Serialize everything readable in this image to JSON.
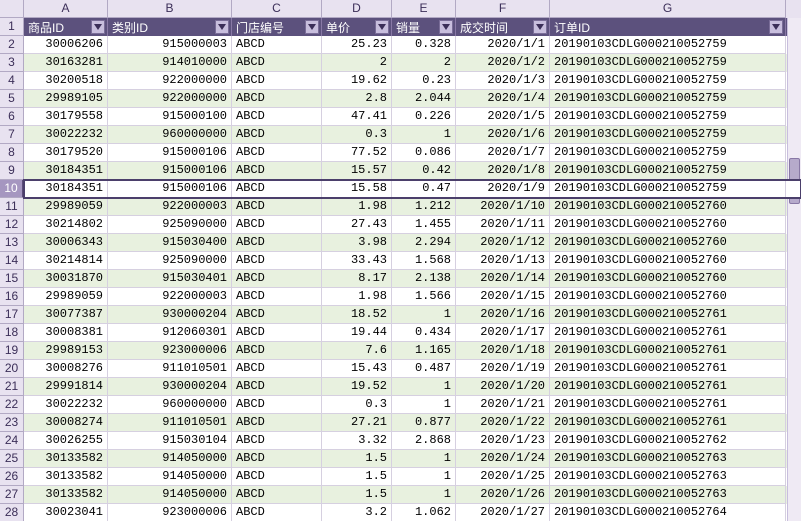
{
  "columns": [
    "A",
    "B",
    "C",
    "D",
    "E",
    "F",
    "G"
  ],
  "selected_row": 10,
  "headers": {
    "A": "商品ID",
    "B": "类别ID",
    "C": "门店编号",
    "D": "单价",
    "E": "销量",
    "F": "成交时间",
    "G": "订单ID"
  },
  "chart_data": {
    "type": "table",
    "columns": [
      "商品ID",
      "类别ID",
      "门店编号",
      "单价",
      "销量",
      "成交时间",
      "订单ID"
    ],
    "rows": [
      [
        "30006206",
        "915000003",
        "ABCD",
        "25.23",
        "0.328",
        "2020/1/1",
        "20190103CDLG000210052759"
      ],
      [
        "30163281",
        "914010000",
        "ABCD",
        "2",
        "2",
        "2020/1/2",
        "20190103CDLG000210052759"
      ],
      [
        "30200518",
        "922000000",
        "ABCD",
        "19.62",
        "0.23",
        "2020/1/3",
        "20190103CDLG000210052759"
      ],
      [
        "29989105",
        "922000000",
        "ABCD",
        "2.8",
        "2.044",
        "2020/1/4",
        "20190103CDLG000210052759"
      ],
      [
        "30179558",
        "915000100",
        "ABCD",
        "47.41",
        "0.226",
        "2020/1/5",
        "20190103CDLG000210052759"
      ],
      [
        "30022232",
        "960000000",
        "ABCD",
        "0.3",
        "1",
        "2020/1/6",
        "20190103CDLG000210052759"
      ],
      [
        "30179520",
        "915000106",
        "ABCD",
        "77.52",
        "0.086",
        "2020/1/7",
        "20190103CDLG000210052759"
      ],
      [
        "30184351",
        "915000106",
        "ABCD",
        "15.57",
        "0.42",
        "2020/1/8",
        "20190103CDLG000210052759"
      ],
      [
        "30184351",
        "915000106",
        "ABCD",
        "15.58",
        "0.47",
        "2020/1/9",
        "20190103CDLG000210052759"
      ],
      [
        "29989059",
        "922000003",
        "ABCD",
        "1.98",
        "1.212",
        "2020/1/10",
        "20190103CDLG000210052760"
      ],
      [
        "30214802",
        "925090000",
        "ABCD",
        "27.43",
        "1.455",
        "2020/1/11",
        "20190103CDLG000210052760"
      ],
      [
        "30006343",
        "915030400",
        "ABCD",
        "3.98",
        "2.294",
        "2020/1/12",
        "20190103CDLG000210052760"
      ],
      [
        "30214814",
        "925090000",
        "ABCD",
        "33.43",
        "1.568",
        "2020/1/13",
        "20190103CDLG000210052760"
      ],
      [
        "30031870",
        "915030401",
        "ABCD",
        "8.17",
        "2.138",
        "2020/1/14",
        "20190103CDLG000210052760"
      ],
      [
        "29989059",
        "922000003",
        "ABCD",
        "1.98",
        "1.566",
        "2020/1/15",
        "20190103CDLG000210052760"
      ],
      [
        "30077387",
        "930000204",
        "ABCD",
        "18.52",
        "1",
        "2020/1/16",
        "20190103CDLG000210052761"
      ],
      [
        "30008381",
        "912060301",
        "ABCD",
        "19.44",
        "0.434",
        "2020/1/17",
        "20190103CDLG000210052761"
      ],
      [
        "29989153",
        "923000006",
        "ABCD",
        "7.6",
        "1.165",
        "2020/1/18",
        "20190103CDLG000210052761"
      ],
      [
        "30008276",
        "911010501",
        "ABCD",
        "15.43",
        "0.487",
        "2020/1/19",
        "20190103CDLG000210052761"
      ],
      [
        "29991814",
        "930000204",
        "ABCD",
        "19.52",
        "1",
        "2020/1/20",
        "20190103CDLG000210052761"
      ],
      [
        "30022232",
        "960000000",
        "ABCD",
        "0.3",
        "1",
        "2020/1/21",
        "20190103CDLG000210052761"
      ],
      [
        "30008274",
        "911010501",
        "ABCD",
        "27.21",
        "0.877",
        "2020/1/22",
        "20190103CDLG000210052761"
      ],
      [
        "30026255",
        "915030104",
        "ABCD",
        "3.32",
        "2.868",
        "2020/1/23",
        "20190103CDLG000210052762"
      ],
      [
        "30133582",
        "914050000",
        "ABCD",
        "1.5",
        "1",
        "2020/1/24",
        "20190103CDLG000210052763"
      ],
      [
        "30133582",
        "914050000",
        "ABCD",
        "1.5",
        "1",
        "2020/1/25",
        "20190103CDLG000210052763"
      ],
      [
        "30133582",
        "914050000",
        "ABCD",
        "1.5",
        "1",
        "2020/1/26",
        "20190103CDLG000210052763"
      ],
      [
        "30023041",
        "923000006",
        "ABCD",
        "3.2",
        "1.062",
        "2020/1/27",
        "20190103CDLG000210052764"
      ]
    ]
  }
}
